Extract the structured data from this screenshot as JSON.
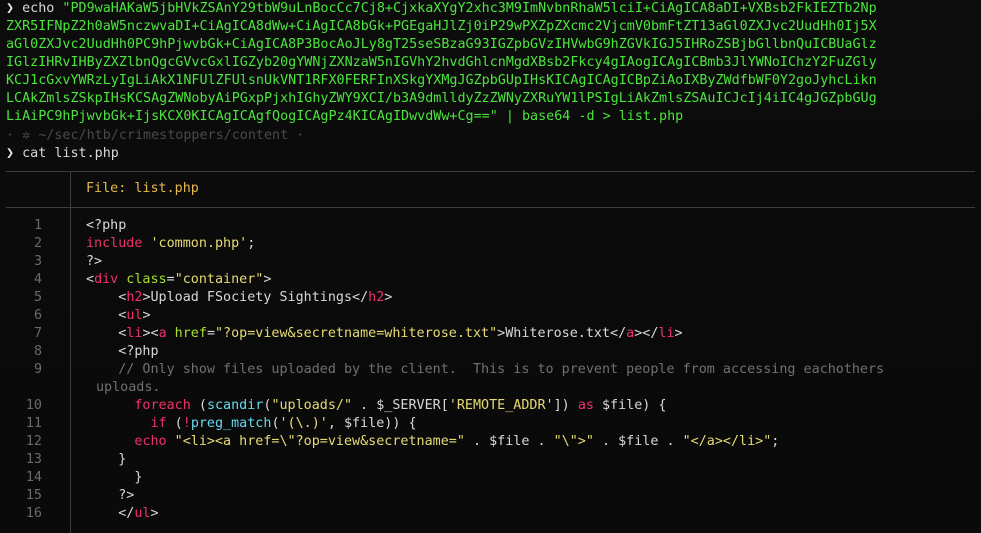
{
  "terminal": {
    "prompt_symbol": "❯",
    "echo_cmd": "echo",
    "b64_lines": [
      " \"PD9waHAKaW5jbHVkZSAnY29tbW9uLnBocCc7Cj8+CjxkaXYgY2xhc3M9ImNvbnRhaW5lciI+CiAgICA8aDI+VXBsb2FkIEZTb2Np",
      "ZXR5IFNpZ2h0aW5nczwvaDI+CiAgICA8dWw+CiAgICA8bGk+PGEgaHJlZj0iP29wPXZpZXcmc2VjcmV0bmFtZT13aGl0ZXJvc2UudHh0Ij5X",
      "aGl0ZXJvc2UudHh0PC9hPjwvbGk+CiAgICA8P3BocAoJLy8gT25seSBzaG93IGZpbGVzIHVwbG9hZGVkIGJ5IHRoZSBjbGllbnQuICBUaGlz",
      "IGlzIHRvIHByZXZlbnQgcGVvcGxlIGZyb20gYWNjZXNzaW5nIGVhY2hvdGhlcnMgdXBsb2Fkcy4gIAogICAgICBmb3JlYWNoIChzY2FuZGly",
      "KCJ1cGxvYWRzLyIgLiAkX1NFUlZFUlsnUkVNT1RFX0FERFInXSkgYXMgJGZpbGUpIHsKICAgICAgICBpZiAoIXByZWdfbWF0Y2goJyhcLikn",
      "LCAkZmlsZSkpIHsKCSAgZWNobyAiPGxpPjxhIGhyZWY9XCI/b3A9dmlldyZzZWNyZXRuYW1lPSIgLiAkZmlsZSAuICJcIj4iIC4gJGZpbGUg",
      "LiAiPC9hPjwvbGk+IjsKCX0KICAgICAgfQogICAgPz4KICAgIDwvdWw+Cg==\" | base64 -d > list.php"
    ],
    "path_line": "· ✲ ~/sec/htb/crimestoppers/content ·",
    "cat_cmd": "cat list.php"
  },
  "viewer": {
    "file_label": "File: list.php",
    "lines": [
      {
        "n": "1"
      },
      {
        "n": "2"
      },
      {
        "n": "3"
      },
      {
        "n": "4"
      },
      {
        "n": "5"
      },
      {
        "n": "6"
      },
      {
        "n": "7"
      },
      {
        "n": "8"
      },
      {
        "n": "9"
      },
      {
        "n": ""
      },
      {
        "n": "10"
      },
      {
        "n": "11"
      },
      {
        "n": "12"
      },
      {
        "n": "13"
      },
      {
        "n": "14"
      },
      {
        "n": "15"
      },
      {
        "n": "16"
      }
    ],
    "code": {
      "l1": "<?php",
      "l2a": "include",
      "l2b": " 'common.php'",
      "l2c": ";",
      "l3": "?>",
      "l4_open": "<",
      "l4_tag": "div",
      "l4_attr": " class",
      "l4_eq": "=",
      "l4_val": "\"container\"",
      "l4_close": ">",
      "l5_pre": "    <",
      "l5_tag": "h2",
      "l5_mid": ">Upload FSociety Sightings</",
      "l5_tag2": "h2",
      "l5_end": ">",
      "l6_pre": "    <",
      "l6_tag": "ul",
      "l6_end": ">",
      "l7_pre": "    <",
      "l7_li": "li",
      "l7_gt": "><",
      "l7_a": "a",
      "l7_href": " href",
      "l7_eq": "=",
      "l7_val": "\"?op=view&secretname=whiterose.txt\"",
      "l7_text": ">Whiterose.txt</",
      "l7_a2": "a",
      "l7_mid": "></",
      "l7_li2": "li",
      "l7_end": ">",
      "l8": "    <?php",
      "l9": "    // Only show files uploaded by the client.  This is to prevent people from accessing eachothers",
      "l9b": "uploads.",
      "l10_kw": "      foreach",
      "l10_a": " (",
      "l10_fn": "scandir",
      "l10_b": "(",
      "l10_s1": "\"uploads/\"",
      "l10_c": " . $_SERVER[",
      "l10_s2": "'REMOTE_ADDR'",
      "l10_d": "]) ",
      "l10_as": "as",
      "l10_e": " $file) {",
      "l11_kw": "        if",
      "l11_a": " (",
      "l11_not": "!",
      "l11_fn": "preg_match",
      "l11_b": "(",
      "l11_s": "'(\\.)'",
      "l11_c": ", $file)) {",
      "l12_kw": "      echo",
      "l12_s1": " \"<li><a href=\\\"?op=view&secretname=\"",
      "l12_a": " . $file . ",
      "l12_s2": "\"\\\">\"",
      "l12_b": " . $file . ",
      "l12_s3": "\"</a></li>\"",
      "l12_c": ";",
      "l13": "    }",
      "l14": "      }",
      "l15": "    ?>",
      "l16_pre": "    </",
      "l16_tag": "ul",
      "l16_end": ">"
    }
  }
}
